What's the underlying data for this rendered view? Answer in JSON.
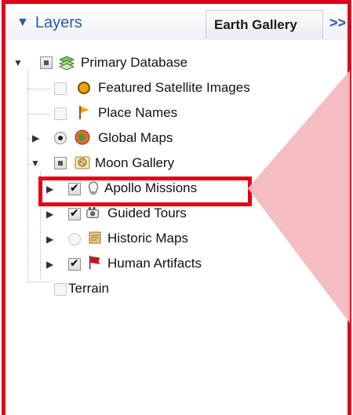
{
  "header": {
    "layers_title": "Layers",
    "tab_label": "Earth Gallery",
    "more_label": ">>"
  },
  "tree": {
    "primary_database": "Primary Database",
    "featured_satellite_images": "Featured Satellite Images",
    "place_names": "Place Names",
    "global_maps": "Global Maps",
    "moon_gallery": "Moon Gallery",
    "apollo_missions": "Apollo Missions",
    "guided_tours": "Guided Tours",
    "historic_maps": "Historic Maps",
    "human_artifacts": "Human Artifacts",
    "terrain": "Terrain"
  },
  "icons": {
    "primary_database": "layers-stack-icon",
    "featured_satellite_images": "orange-dot-icon",
    "place_names": "flag-pin-icon",
    "global_maps": "globe-map-icon",
    "moon_gallery": "moon-gallery-icon",
    "apollo_missions": "lightbulb-icon",
    "guided_tours": "camera-icon",
    "historic_maps": "scroll-icon",
    "human_artifacts": "red-flag-icon"
  },
  "colors": {
    "annotation_red": "#e2001a",
    "callout_pink": "#f3b9bf",
    "header_blue": "#2f5aa8"
  }
}
